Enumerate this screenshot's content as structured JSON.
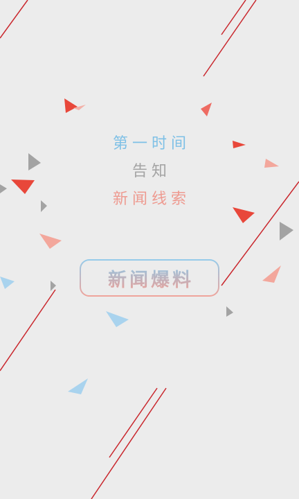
{
  "splash": {
    "taglines": [
      "第一时间",
      "告知",
      "新闻线索"
    ],
    "button_label": "新闻爆料"
  },
  "colors": {
    "background": "#ececec",
    "blue": "#7ec0e6",
    "gray": "#a4a4a4",
    "pink": "#ee9a90",
    "red": "#e8473a",
    "line_red": "#c9262c"
  }
}
